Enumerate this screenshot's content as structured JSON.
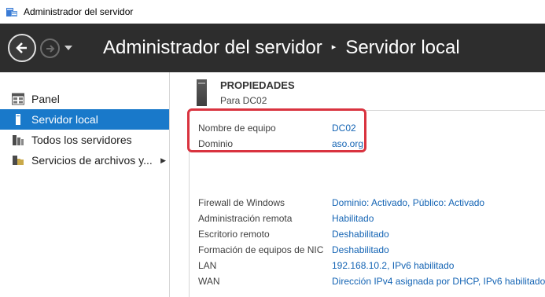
{
  "window": {
    "title": "Administrador del servidor"
  },
  "header": {
    "breadcrumb_root": "Administrador del servidor",
    "breadcrumb_separator": "▸",
    "breadcrumb_current": "Servidor local"
  },
  "sidebar": {
    "items": [
      {
        "label": "Panel",
        "icon": "dashboard-icon",
        "active": false
      },
      {
        "label": "Servidor local",
        "icon": "server-icon",
        "active": true
      },
      {
        "label": "Todos los servidores",
        "icon": "servers-icon",
        "active": false
      },
      {
        "label": "Servicios de archivos y...",
        "icon": "file-services-icon",
        "active": false,
        "has_submenu": true
      }
    ],
    "submenu_arrow": "▶"
  },
  "properties": {
    "title": "PROPIEDADES",
    "subtitle": "Para DC02",
    "identity": [
      {
        "label": "Nombre de equipo",
        "value": "DC02"
      },
      {
        "label": "Dominio",
        "value": "aso.org"
      }
    ],
    "settings": [
      {
        "label": "Firewall de Windows",
        "value": "Dominio: Activado, Público: Activado"
      },
      {
        "label": "Administración remota",
        "value": "Habilitado"
      },
      {
        "label": "Escritorio remoto",
        "value": "Deshabilitado"
      },
      {
        "label": "Formación de equipos de NIC",
        "value": "Deshabilitado"
      },
      {
        "label": "LAN",
        "value": "192.168.10.2, IPv6 habilitado"
      },
      {
        "label": "WAN",
        "value": "Dirección IPv4 asignada por DHCP, IPv6 habilitado"
      }
    ]
  },
  "colors": {
    "header_bg": "#2d2d2d",
    "active_item": "#1979ca",
    "link": "#1464b4",
    "highlight": "#d9333f"
  }
}
